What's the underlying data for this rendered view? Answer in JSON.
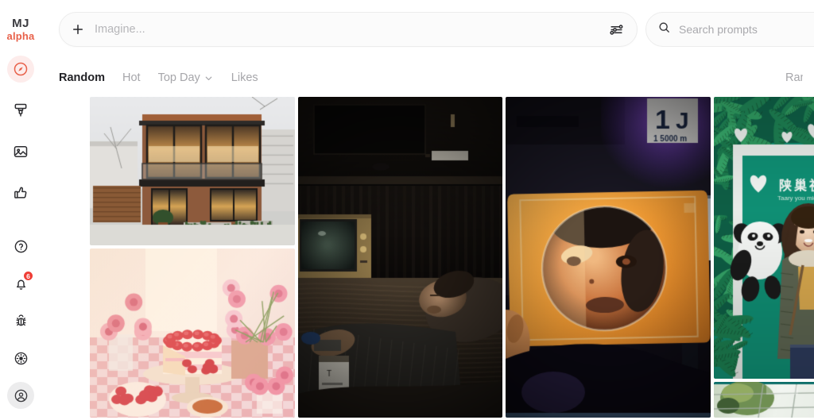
{
  "sidebar": {
    "brand": {
      "mj": "MJ",
      "alpha": "alpha"
    },
    "top_items": [
      {
        "name": "explore",
        "icon": "compass-icon",
        "active": true
      },
      {
        "name": "create",
        "icon": "paintbrush-icon",
        "active": false
      },
      {
        "name": "gallery",
        "icon": "image-icon",
        "active": false
      },
      {
        "name": "likes",
        "icon": "thumbs-up-icon",
        "active": false
      }
    ],
    "bottom_items": [
      {
        "name": "help",
        "icon": "question-circle-icon",
        "badge": ""
      },
      {
        "name": "notifications",
        "icon": "bell-icon",
        "badge": "6"
      },
      {
        "name": "report-bug",
        "icon": "bug-icon",
        "badge": ""
      },
      {
        "name": "theme",
        "icon": "sun-icon",
        "badge": ""
      },
      {
        "name": "account",
        "icon": "user-circle-icon",
        "badge": ""
      }
    ],
    "notification_count": "6"
  },
  "topbar": {
    "plus_icon": "plus-icon",
    "imagine": {
      "value": "",
      "placeholder": "Imagine..."
    },
    "settings_icon": "sliders-icon",
    "search": {
      "value": "",
      "placeholder": "Search prompts",
      "icon": "search-icon"
    }
  },
  "tabs": {
    "items": [
      {
        "label": "Random",
        "active": true,
        "chevron": false
      },
      {
        "label": "Hot",
        "active": false,
        "chevron": false
      },
      {
        "label": "Top Day",
        "active": false,
        "chevron": true
      },
      {
        "label": "Likes",
        "active": false,
        "chevron": false
      }
    ],
    "right_label": "Rank"
  },
  "gallery": {
    "columns": [
      {
        "tiles": [
          {
            "name": "modern-house-image",
            "alt": "Modern two-storey house with wood cladding, brick and large glass windows at dusk"
          },
          {
            "name": "strawberry-cake-image",
            "alt": "Strawberry layer cake with pink roses on a checkered tablecloth in sunlight"
          }
        ]
      },
      {
        "tiles": [
          {
            "name": "man-sleeping-van-image",
            "alt": "Man asleep on a couch in a dark camper van lit by a vintage television"
          }
        ]
      },
      {
        "tiles": [
          {
            "name": "orange-acrylic-portrait-image",
            "alt": "Hand holding an orange translucent square showing a distorted face at night"
          }
        ]
      },
      {
        "tiles": [
          {
            "name": "panda-mural-portrait-image",
            "alt": "Woman in green jacket in front of a green panda mural with ferns and hearts"
          },
          {
            "name": "glass-roof-image",
            "alt": "Glass ceiling panels reflecting trees"
          }
        ]
      }
    ]
  },
  "colors": {
    "accent": "#e8614a",
    "accent_soft": "#fdeceb",
    "badge": "#ef3e36",
    "text_primary": "#222226",
    "text_muted": "#a6a6aa",
    "border": "#ececec",
    "background": "#ffffff"
  }
}
